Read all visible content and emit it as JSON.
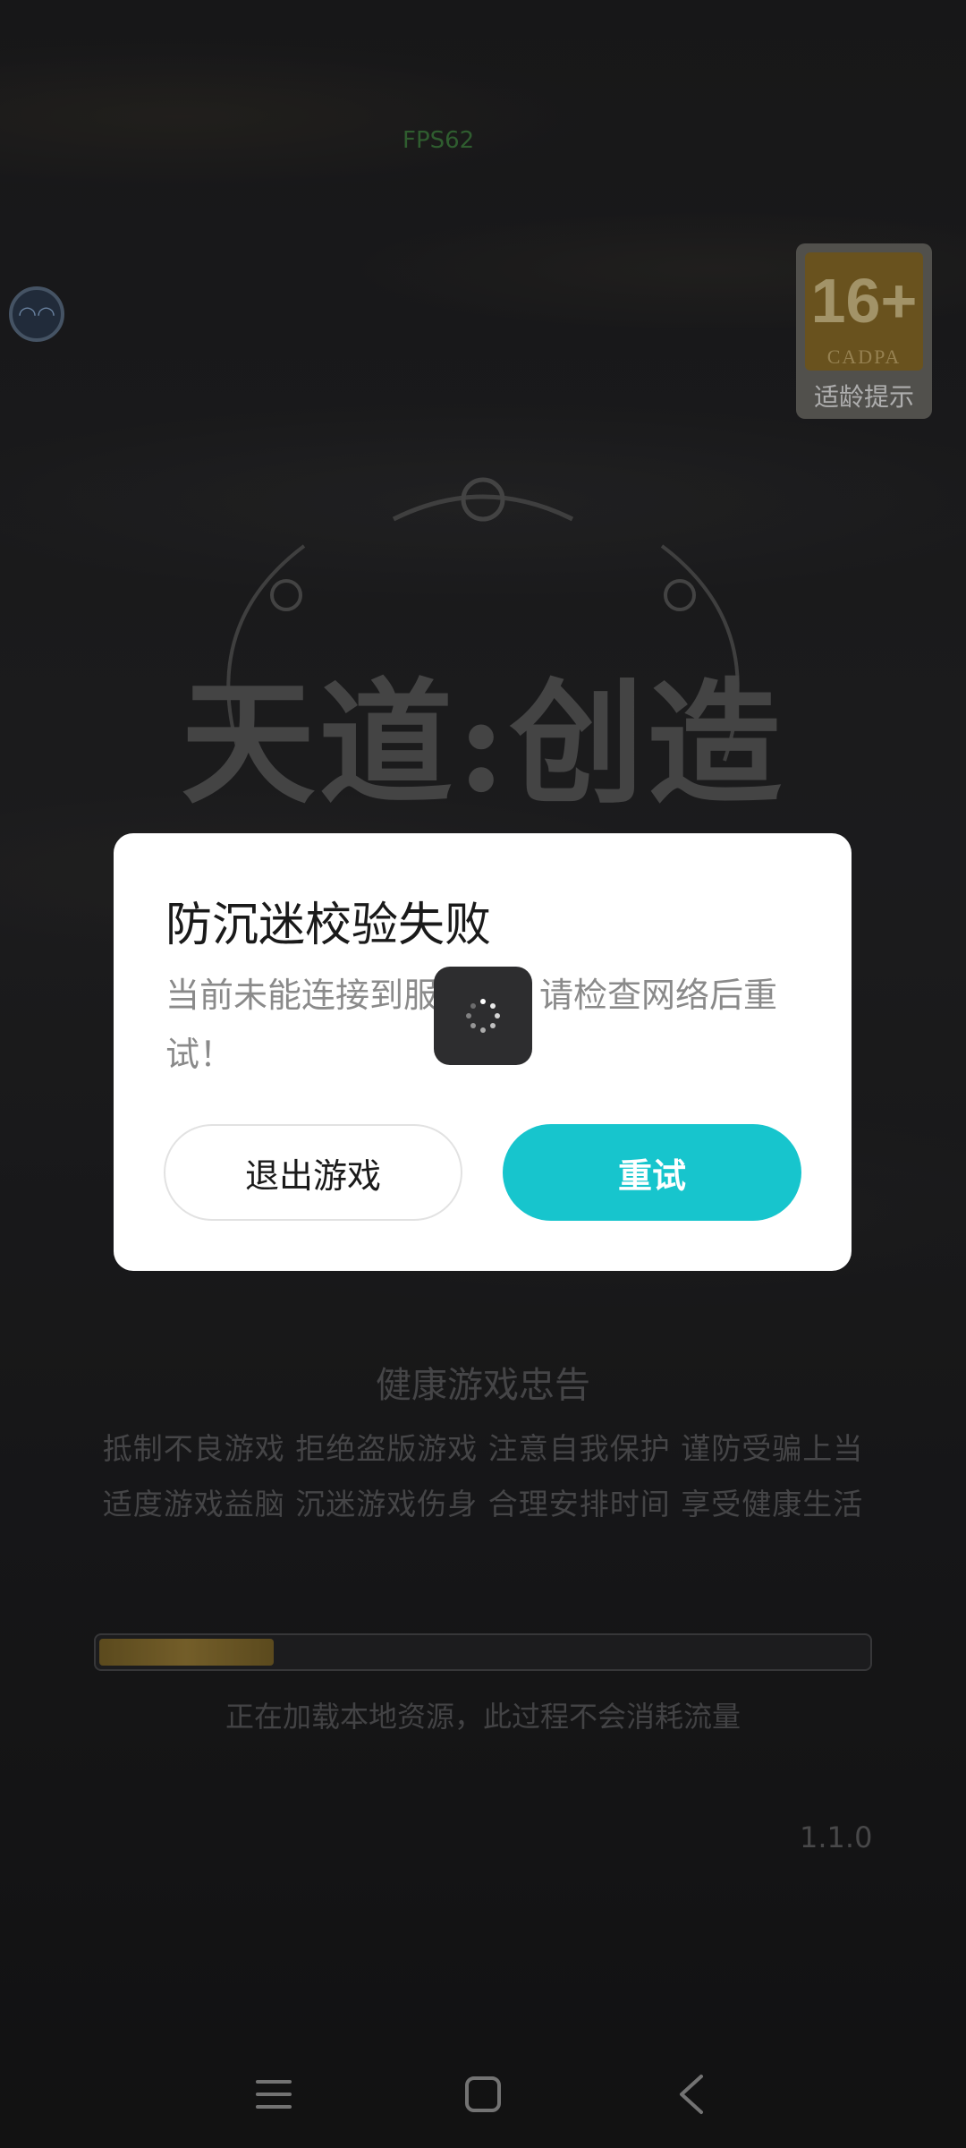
{
  "status_overlay": {
    "fps": "FPS62"
  },
  "age_rating": {
    "rating": "16+",
    "org": "CADPA",
    "label": "适龄提示"
  },
  "game": {
    "logo_title": "天道:创造"
  },
  "health_advice": {
    "title": "健康游戏忠告",
    "line1": "抵制不良游戏  拒绝盗版游戏  注意自我保护  谨防受骗上当",
    "line2": "适度游戏益脑  沉迷游戏伤身  合理安排时间  享受健康生活"
  },
  "loading": {
    "progress_fraction": 0.23,
    "text": "正在加载本地资源，此过程不会消耗流量",
    "version": "1.1.0"
  },
  "dialog": {
    "title": "防沉迷校验失败",
    "message": "当前未能连接到服务器，请检查网络后重试！",
    "exit_label": "退出游戏",
    "retry_label": "重试"
  },
  "colors": {
    "accent": "#17c5cd",
    "progress": "#9a7d37"
  },
  "navigation": {
    "icons": [
      "menu-icon",
      "home-icon",
      "back-icon"
    ]
  }
}
